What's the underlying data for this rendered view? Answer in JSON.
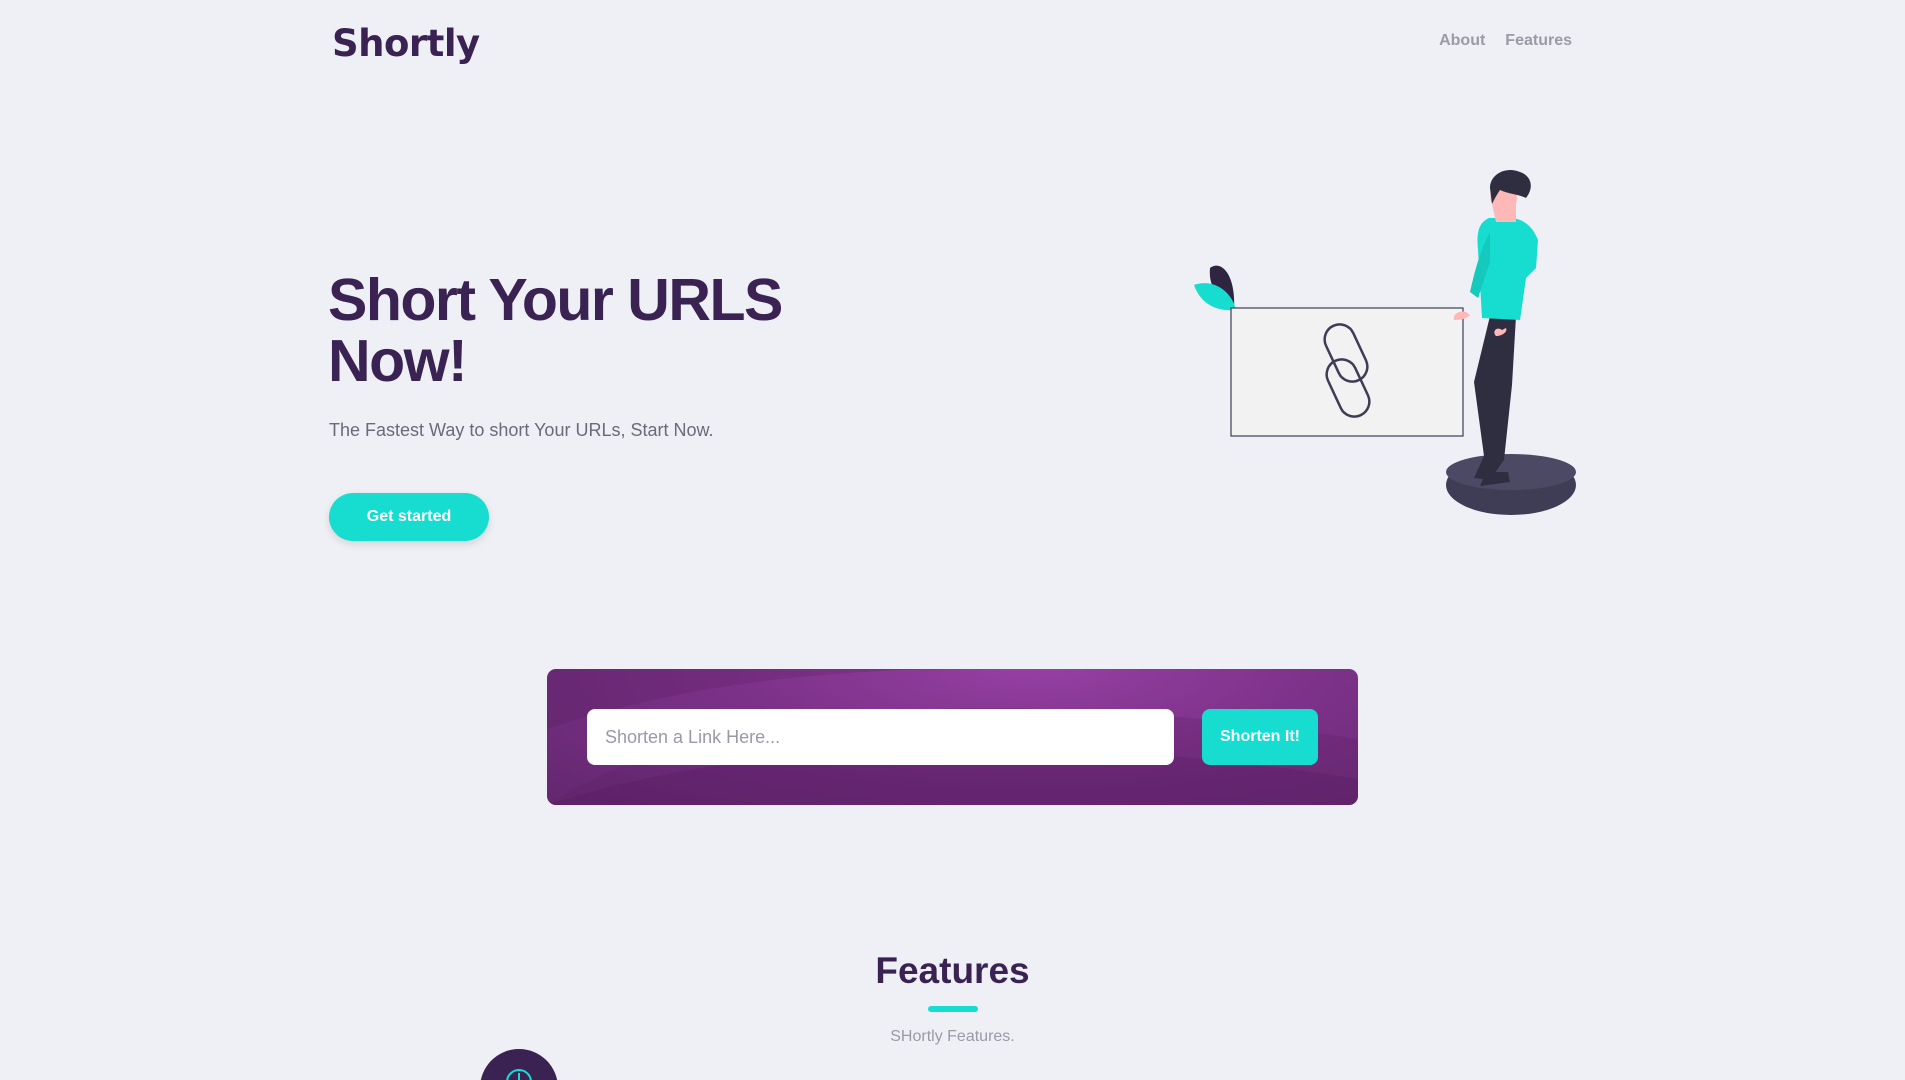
{
  "header": {
    "logo": "Shortly",
    "nav": [
      {
        "label": "About"
      },
      {
        "label": "Features"
      }
    ]
  },
  "hero": {
    "title": "Short Your URLS Now!",
    "subtitle": "The Fastest Way to short Your URLs, Start Now.",
    "cta_label": "Get started",
    "illustration_icon": "link-chain-icon"
  },
  "shortener": {
    "placeholder": "Shorten a Link Here...",
    "input_value": "",
    "button_label": "Shorten It!"
  },
  "features": {
    "title": "Features",
    "subtitle": "SHortly Features.",
    "first_icon": "feature-icon"
  },
  "colors": {
    "brand": "#3a2352",
    "accent": "#17ddd0",
    "panel": "#7b3187",
    "background": "#eef0f5",
    "muted_text": "#9b9aa6"
  }
}
